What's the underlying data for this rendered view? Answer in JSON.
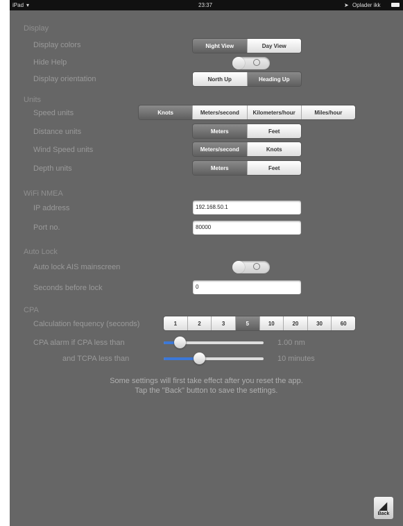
{
  "status_bar": {
    "carrier": "iPad",
    "time": "23:37",
    "battery_text": "Oplader ikk"
  },
  "display": {
    "header": "Display",
    "colors_label": "Display colors",
    "colors_options": [
      "Night View",
      "Day View"
    ],
    "help_label": "Hide Help",
    "orientation_label": "Display orientation",
    "orientation_options": [
      "North Up",
      "Heading Up"
    ]
  },
  "units": {
    "header": "Units",
    "speed_label": "Speed units",
    "speed_options": [
      "Knots",
      "Meters/second",
      "Kilometers/hour",
      "Miles/hour"
    ],
    "distance_label": "Distance units",
    "distance_options": [
      "Meters",
      "Feet"
    ],
    "wind_label": "Wind Speed units",
    "wind_options": [
      "Meters/second",
      "Knots"
    ],
    "depth_label": "Depth units",
    "depth_options": [
      "Meters",
      "Feet"
    ]
  },
  "wifi": {
    "header": "WiFi NMEA",
    "ip_label": "IP address",
    "ip_value": "192.168.50.1",
    "port_label": "Port no.",
    "port_value": "80000"
  },
  "autolock": {
    "header": "Auto Lock",
    "ais_label": "Auto lock AIS mainscreen",
    "seconds_label": "Seconds before lock",
    "seconds_value": "0"
  },
  "cpa": {
    "header": "CPA",
    "freq_label": "Calculation fequency (seconds)",
    "freq_options": [
      "1",
      "2",
      "3",
      "5",
      "10",
      "20",
      "30",
      "60"
    ],
    "alarm_label": "CPA alarm if CPA less than",
    "alarm_value": "1.00 nm",
    "alarm_level": 0.12,
    "tcpa_label": "and TCPA less than",
    "tcpa_value": "10 minutes",
    "tcpa_level": 0.34
  },
  "notes": {
    "line1": "Some settings will first take effect after you reset the app.",
    "line2": "Tap the \"Back\" button to save the settings."
  },
  "back_button": {
    "label": "Back",
    "icon": "k-logo-icon"
  }
}
